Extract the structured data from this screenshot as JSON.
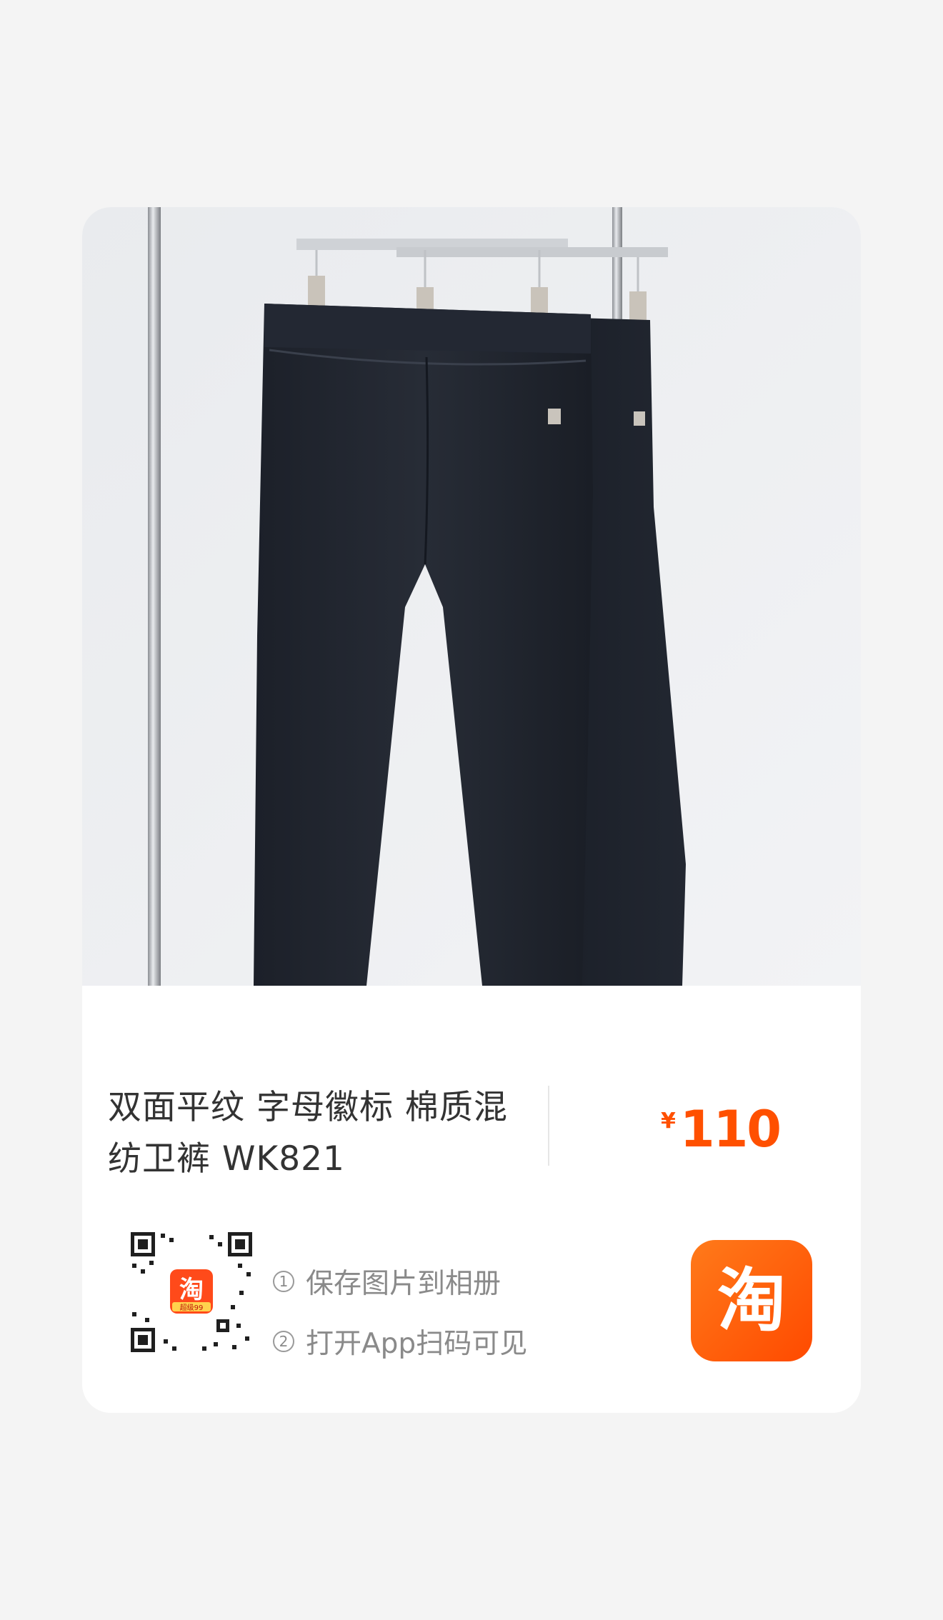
{
  "product": {
    "title": "双面平纹 字母徽标 棉质混纺卫裤 WK821",
    "price_currency": "¥",
    "price_value": "110",
    "image_icon": "product-photo-black-sweatpants"
  },
  "qr": {
    "center_logo_text": "淘",
    "center_badge_text": "超级99",
    "icon": "qr-code-icon"
  },
  "steps": [
    {
      "number": "1",
      "text": "保存图片到相册"
    },
    {
      "number": "2",
      "text": "打开App扫码可见"
    }
  ],
  "taobao": {
    "logo_text": "淘",
    "icon": "taobao-logo-icon"
  },
  "colors": {
    "accent": "#ff5000",
    "title_text": "#333333",
    "muted_text": "#8a8a8a",
    "background": "#f4f4f4",
    "card": "#ffffff"
  }
}
